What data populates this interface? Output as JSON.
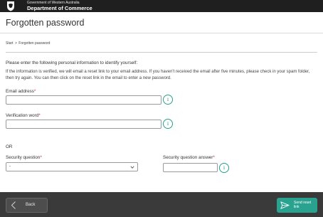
{
  "header": {
    "gov_line1": "Government of Western Australia",
    "gov_line2": "Department of Commerce",
    "crest_icon": "wa-crest-icon"
  },
  "page": {
    "title": "Forgotten password"
  },
  "breadcrumb": {
    "start": "Start",
    "separator": ">",
    "current": "Forgotten password"
  },
  "form": {
    "intro": "Please enter the following personal information to identify yourself:",
    "info": "If the information is verified, we will email a reset link to your email address. If you haven't received the email after five minutes, please check in your spam folder, then try again. You can then click on the reset link in the email to enter a new password.",
    "email_label": "Email address",
    "email_value": "",
    "verification_label": "Verification word",
    "verification_value": "",
    "or_label": "OR",
    "security_question_label": "Security question",
    "security_question_value": "-",
    "security_answer_label": "Security question answer",
    "security_answer_value": "",
    "required_marker": "*",
    "info_icon_glyph": "i"
  },
  "footer": {
    "back_label": "Back",
    "send_label": "Send reset link"
  },
  "colors": {
    "accent": "#2aa290",
    "required": "#d9252a",
    "header_bg": "#1f1f1f",
    "footer_bg": "#3a3a3a"
  }
}
